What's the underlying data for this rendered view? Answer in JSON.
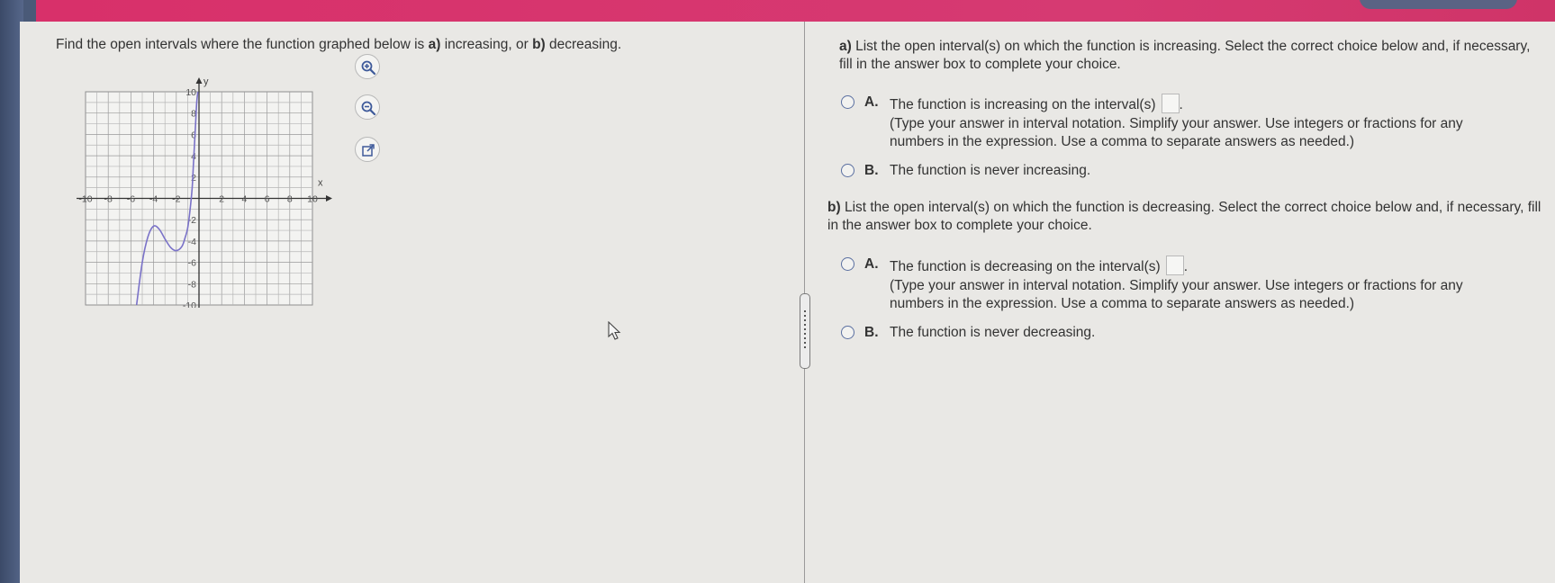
{
  "question": {
    "text_before": "Find the open intervals where the function graphed below is ",
    "part_a_letter": "a)",
    "text_middle": " increasing, or ",
    "part_b_letter": "b)",
    "text_after": " decreasing."
  },
  "graph": {
    "x_axis_label": "x",
    "y_axis_label": "y",
    "x_range": [
      -10,
      10
    ],
    "y_range": [
      -10,
      10
    ],
    "x_tick_labels": [
      "-10",
      "-8",
      "-6",
      "-4",
      "-2",
      "2",
      "4",
      "6",
      "8",
      "10"
    ],
    "y_tick_labels": [
      "10",
      "8",
      "6",
      "4",
      "2",
      "-2",
      "-4",
      "-6",
      "-8",
      "-10"
    ],
    "curve_color": "#7a72c8",
    "curve_points": [
      [
        -5.5,
        -10
      ],
      [
        -5,
        -6
      ],
      [
        -4.5,
        -3.6
      ],
      [
        -4,
        -2.6
      ],
      [
        -3.5,
        -2.9
      ],
      [
        -3,
        -3.8
      ],
      [
        -2.5,
        -4.6
      ],
      [
        -2,
        -4.9
      ],
      [
        -1.5,
        -4.5
      ],
      [
        -1.2,
        -3.6
      ],
      [
        -1,
        -2.8
      ],
      [
        -0.8,
        -1.2
      ],
      [
        -0.6,
        1
      ],
      [
        -0.5,
        3
      ],
      [
        -0.4,
        5
      ],
      [
        -0.3,
        7
      ],
      [
        -0.2,
        9
      ],
      [
        -0.1,
        10
      ]
    ]
  },
  "tools": {
    "zoom_in": "zoom-in-icon",
    "zoom_out": "zoom-out-icon",
    "popout": "popout-icon"
  },
  "part_a": {
    "label": "a)",
    "prompt": "List the open interval(s) on which the function is increasing. Select the correct choice below and, if necessary, fill in the answer box to complete your choice.",
    "choice_a_letter": "A.",
    "choice_a_text": "The function is increasing on the interval(s)",
    "choice_a_hint": "(Type your answer in interval notation. Simplify your answer. Use integers or fractions for any numbers in the expression. Use a comma to separate answers as needed.)",
    "choice_b_letter": "B.",
    "choice_b_text": "The function is never increasing."
  },
  "part_b": {
    "label": "b)",
    "prompt": "List the open interval(s) on which the function is decreasing. Select the correct choice below and, if necessary, fill in the answer box to complete your choice.",
    "choice_a_letter": "A.",
    "choice_a_text": "The function is decreasing on the interval(s)",
    "choice_a_hint": "(Type your answer in interval notation. Simplify your answer. Use integers or fractions for any numbers in the expression. Use a comma to separate answers as needed.)",
    "choice_b_letter": "B.",
    "choice_b_text": "The function is never decreasing."
  },
  "colors": {
    "header": "#d63a72",
    "radio": "#5a6fa0"
  }
}
